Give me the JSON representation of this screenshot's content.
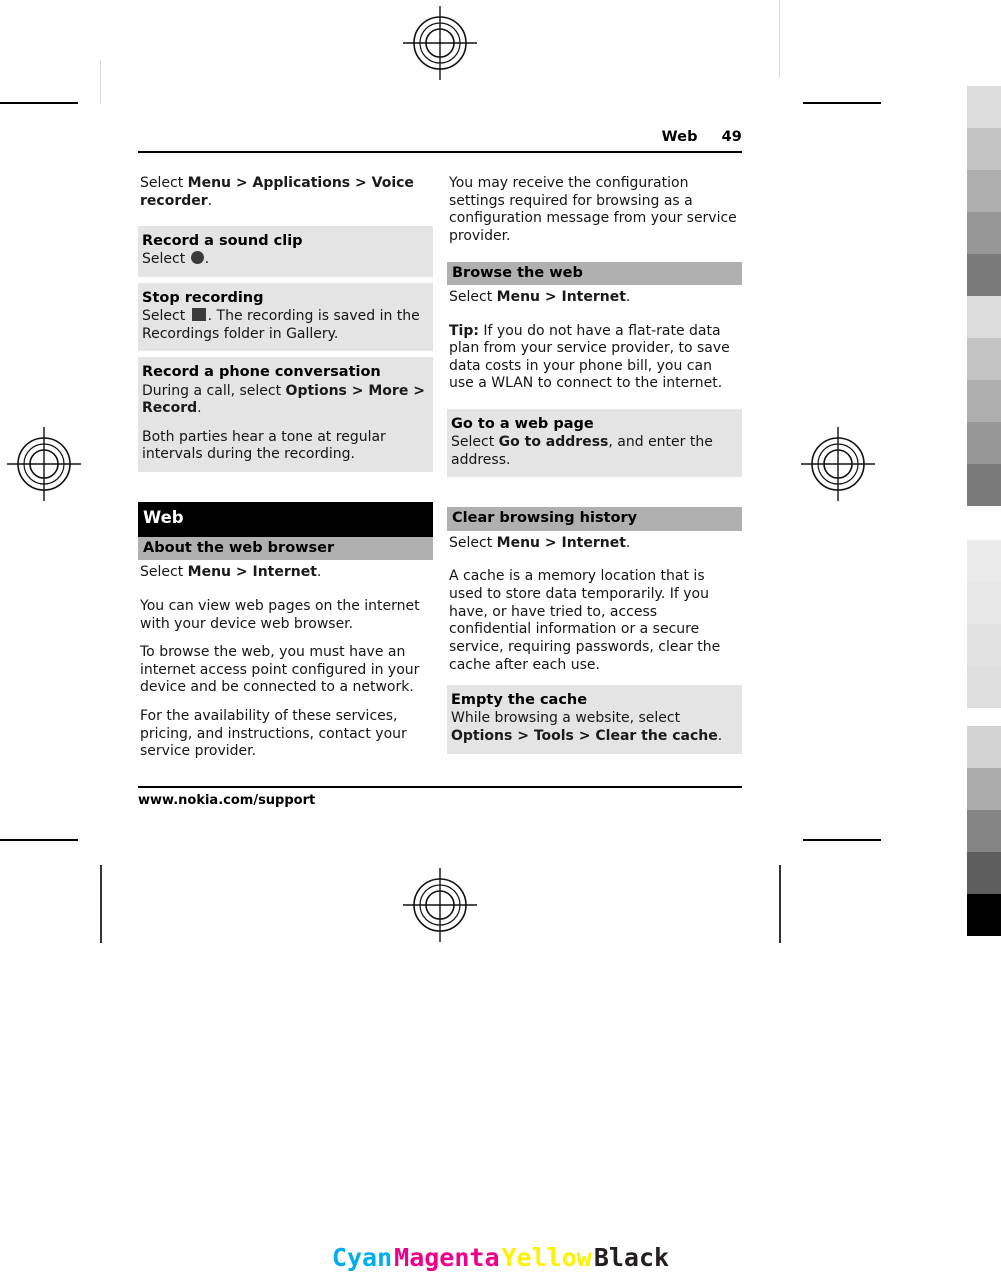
{
  "header": {
    "title": "Web",
    "page_number": "49"
  },
  "footer": {
    "url": "www.nokia.com/support"
  },
  "left_column": {
    "intro": {
      "select": "Select ",
      "menu": "Menu",
      "sep1": " > ",
      "applications": "Applications",
      "sep2": " > ",
      "voice_recorder": "Voice recorder",
      "period": "."
    },
    "record_sound_clip": {
      "heading": "Record a sound clip",
      "text_before": "Select ",
      "text_after": "."
    },
    "stop_recording": {
      "heading": "Stop recording",
      "text_before": "Select ",
      "text_after": ". The recording is saved in the Recordings folder in Gallery."
    },
    "record_phone_conversation": {
      "heading": "Record a phone conversation",
      "line1_a": "During a call, select ",
      "line1_options": "Options",
      "line1_sep1": " > ",
      "line1_more": "More",
      "line1_sep2": " > ",
      "line1_record": "Record",
      "line1_end": ".",
      "line2": "Both parties hear a tone at regular intervals during the recording."
    },
    "web_section_title": "Web",
    "about_web_browser": {
      "heading": "About the web browser",
      "select": "Select ",
      "menu": "Menu",
      "sep": " > ",
      "internet": "Internet",
      "period": "."
    },
    "paragraphs": [
      "You can view web pages on the internet with your device web browser.",
      "To browse the web, you must have an internet access point configured in your device and be connected to a network.",
      "For the availability of these services, pricing, and instructions, contact your service provider."
    ]
  },
  "right_column": {
    "config_paragraph": "You may receive the configuration settings required for browsing as a configuration message from your service provider.",
    "browse_the_web": {
      "heading": "Browse the web",
      "select": "Select ",
      "menu": "Menu",
      "sep": " > ",
      "internet": "Internet",
      "period": "."
    },
    "tip": {
      "label": "Tip:",
      "text": " If you do not have a flat-rate data plan from your service provider, to save data costs in your phone bill, you can use a WLAN to connect to the internet."
    },
    "go_to_web_page": {
      "heading": "Go to a web page",
      "text_before": "Select ",
      "command": "Go to address",
      "text_after": ", and enter the address."
    },
    "clear_browsing_history": {
      "heading": "Clear browsing history",
      "select": "Select ",
      "menu": "Menu",
      "sep": " > ",
      "internet": "Internet",
      "period": "."
    },
    "cache_paragraph": "A cache is a memory location that is used to store data temporarily. If you have, or have tried to, access confidential information or a secure service, requiring passwords, clear the cache after each use.",
    "empty_the_cache": {
      "heading": "Empty the cache",
      "line1": "While browsing a website, select ",
      "options": "Options",
      "sep1": " > ",
      "tools": "Tools",
      "sep2": " > ",
      "clear_cache": "Clear the cache",
      "period": "."
    }
  },
  "print_marks": {
    "cmyk": [
      {
        "label": "Cyan",
        "color": "#00aeef"
      },
      {
        "label": "Magenta",
        "color": "#ec008c"
      },
      {
        "label": "Yellow",
        "color": "#fff200"
      },
      {
        "label": "Black",
        "color": "#231f20"
      }
    ],
    "gray_scale_top": [
      "#dcdcdc",
      "#c4c4c4",
      "#aeaeae",
      "#979797",
      "#7a7a7a"
    ],
    "gray_scale_mid": [
      "#dcdcdc",
      "#c4c4c4",
      "#aeaeae",
      "#979797",
      "#7a7a7a"
    ],
    "gray_scale_faint": [
      "#e9e9e9",
      "#e4e4e4",
      "#e0e0e0",
      "#dedede"
    ],
    "gray_scale_bottom": [
      "#d2d2d2",
      "#ababab",
      "#858585",
      "#5e5e5e",
      "#000000"
    ]
  }
}
